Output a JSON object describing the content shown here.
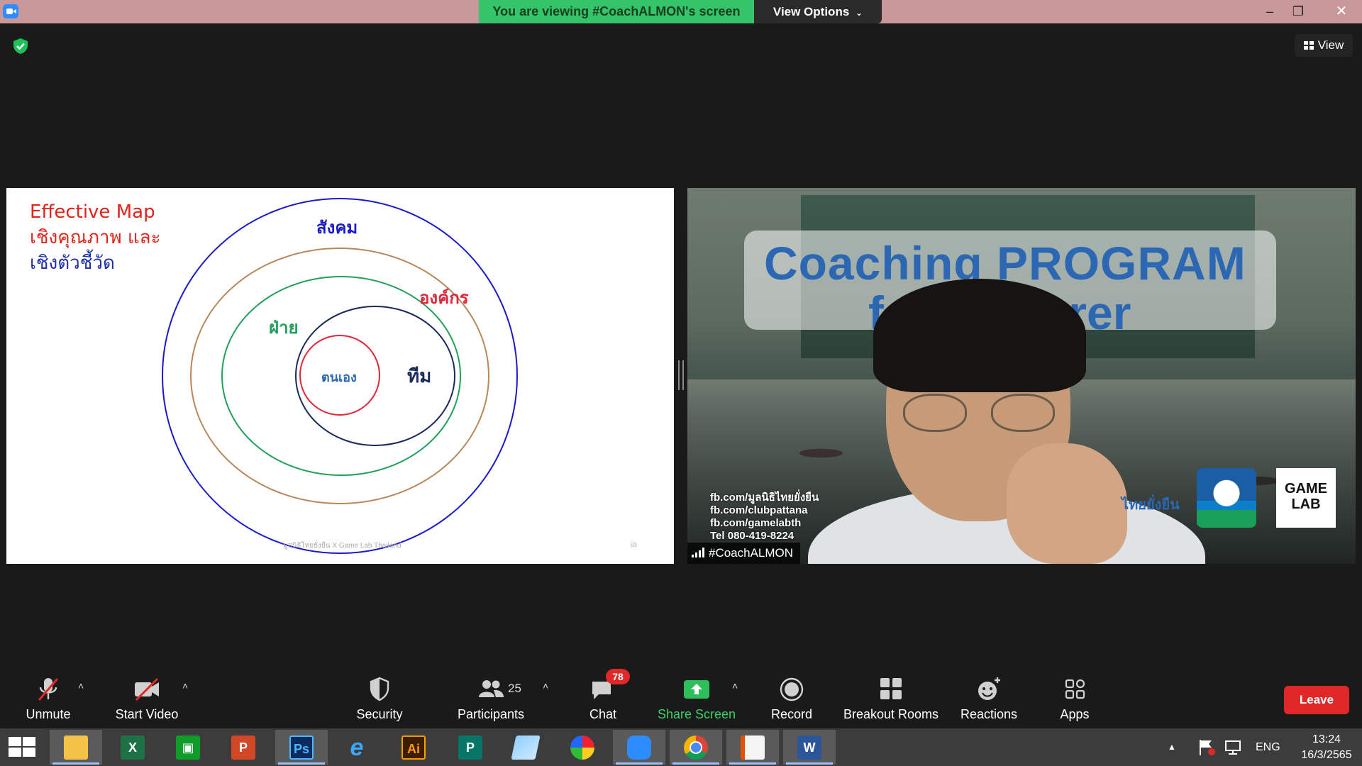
{
  "window": {
    "banner_text": "You are viewing #CoachALMON's screen",
    "view_options_label": "View Options",
    "minimize": "–",
    "maximize": "❐",
    "close": "✕"
  },
  "meeting": {
    "view_label": "View"
  },
  "slide": {
    "title_line1": "Effective Map",
    "title_line2": "เชิงคุณภาพ และ",
    "title_line3": "เชิงตัวชี้วัด",
    "label_society": "สังคม",
    "label_org": "องค์กร",
    "label_dept": "ฝ่าย",
    "label_team": "ทีม",
    "label_self": "ตนเอง",
    "footer": "มูลนิธิไทยยั่งยืน X Game Lab Thailand",
    "page_number": "93"
  },
  "video": {
    "banner_line1": "Coaching PROGRAM",
    "banner_line2": "for Lecturer",
    "contact_line1": "fb.com/มูลนิธิไทยยั่งยืน",
    "contact_line2": "fb.com/clubpattana",
    "contact_line3": "fb.com/gamelabth",
    "contact_line4": "Tel 080-419-8224",
    "inthai": "ไทยยั่งยืน",
    "logo_game": "GAME",
    "logo_lab": "LAB",
    "participant_name": "#CoachALMON"
  },
  "toolbar": {
    "unmute": "Unmute",
    "start_video": "Start Video",
    "security": "Security",
    "participants": "Participants",
    "participants_count": "25",
    "chat": "Chat",
    "chat_badge": "78",
    "share_screen": "Share Screen",
    "record": "Record",
    "breakout_rooms": "Breakout Rooms",
    "reactions": "Reactions",
    "apps": "Apps",
    "leave": "Leave",
    "caret": "˄"
  },
  "taskbar": {
    "excel": "X",
    "store": "▣",
    "powerpoint": "P",
    "photoshop": "Ps",
    "ie": "e",
    "illustrator": "Ai",
    "publisher": "P",
    "word": "W",
    "tray_arrow": "▲",
    "language": "ENG",
    "time": "13:24",
    "date": "16/3/2565"
  },
  "colors": {
    "banner_green": "#35c46a",
    "leave_red": "#e02828",
    "share_green": "#3ad16a",
    "circle_society": "#1a1acc",
    "circle_org": "#b8875a",
    "circle_dept": "#22a05a",
    "circle_team": "#1a2a5a",
    "circle_self": "#e0283a"
  }
}
